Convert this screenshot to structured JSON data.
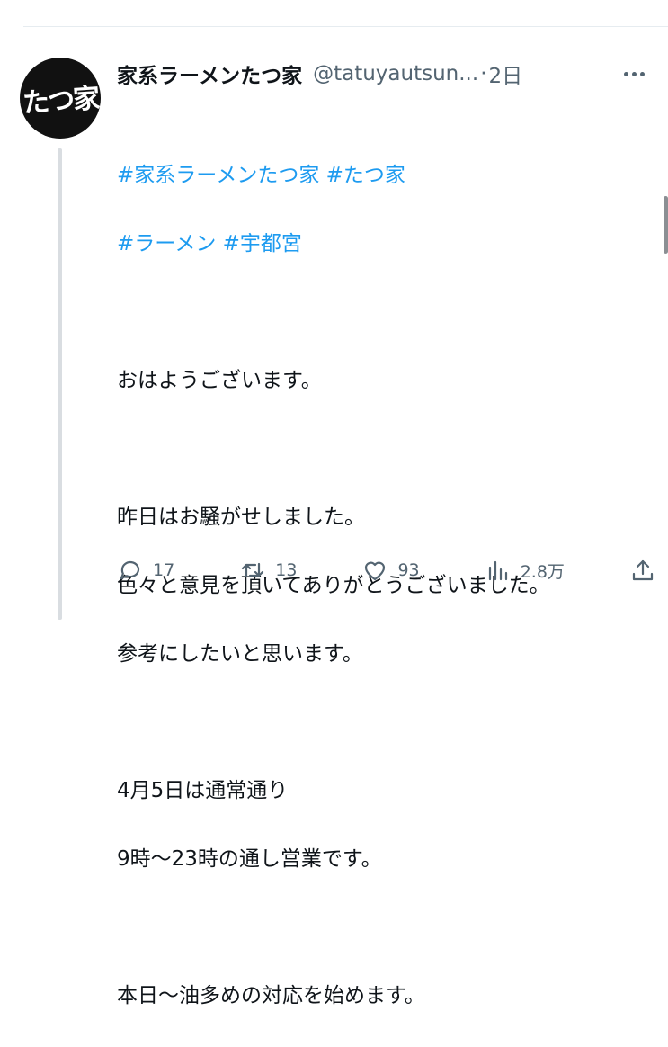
{
  "tweet": {
    "display_name": "家系ラーメンたつ家",
    "handle": "@tatuyautsun...",
    "separator": "·",
    "time": "2日",
    "avatar_text": "たつ家",
    "hashtags_line1": "#家系ラーメンたつ家 #たつ家",
    "hashtags_line2": "#ラーメン #宇都宮",
    "lines": [
      "おはようございます。",
      "",
      "昨日はお騒がせしました。",
      "色々と意見を頂いてありがとうございました。",
      "参考にしたいと思います。",
      "",
      "4月5日は通常通り",
      "9時〜23時の通し営業です。",
      "",
      "本日〜油多めの対応を始めます。"
    ]
  },
  "actions": {
    "reply_count": "17",
    "retweet_count": "13",
    "like_count": "93",
    "views_count": "2.8万"
  },
  "icons": {
    "more": "more-icon",
    "reply": "reply-icon",
    "retweet": "retweet-icon",
    "like": "heart-icon",
    "views": "analytics-icon",
    "share": "share-icon"
  },
  "colors": {
    "hashtag": "#1d9bf0",
    "secondary_text": "#536471",
    "primary_text": "#0f1419"
  }
}
